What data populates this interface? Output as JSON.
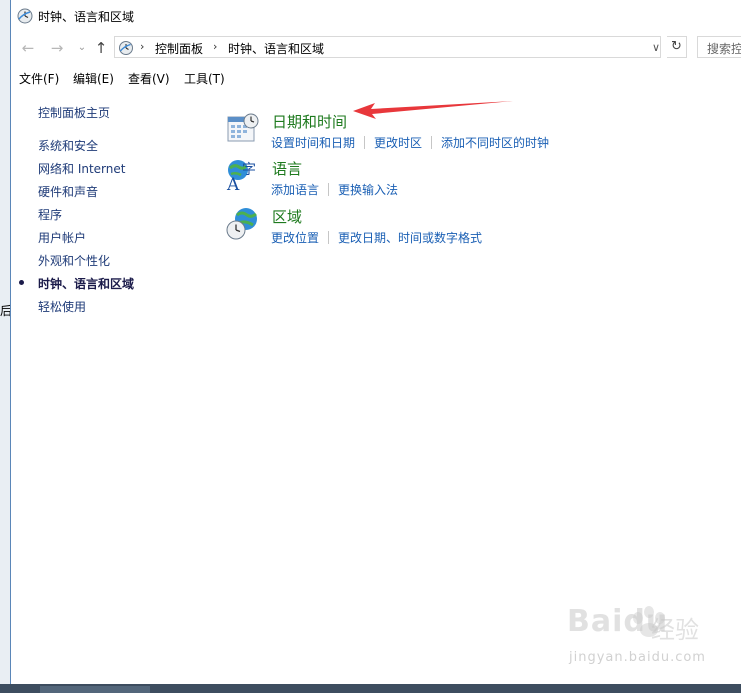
{
  "window": {
    "title": "时钟、语言和区域"
  },
  "nav": {
    "back_label": "←",
    "forward_label": "→",
    "dropdown_label": "⌄",
    "up_label": "↑",
    "breadcrumb": [
      "控制面板",
      "时钟、语言和区域"
    ],
    "breadcrumb_sep": "›",
    "address_dropdown": "∨",
    "refresh_label": "↻",
    "search_placeholder": "搜索控"
  },
  "menubar": {
    "items": [
      "文件(F)",
      "编辑(E)",
      "查看(V)",
      "工具(T)"
    ]
  },
  "sidebar": {
    "home": "控制面板主页",
    "items": [
      "系统和安全",
      "网络和 Internet",
      "硬件和声音",
      "程序",
      "用户帐户",
      "外观和个性化",
      "时钟、语言和区域",
      "轻松使用"
    ],
    "active_index": 6
  },
  "categories": [
    {
      "title": "日期和时间",
      "links": [
        "设置时间和日期",
        "更改时区",
        "添加不同时区的时钟"
      ],
      "icon": "calendar-clock-icon"
    },
    {
      "title": "语言",
      "links": [
        "添加语言",
        "更换输入法"
      ],
      "icon": "language-icon"
    },
    {
      "title": "区域",
      "links": [
        "更改位置",
        "更改日期、时间或数字格式"
      ],
      "icon": "globe-clock-icon"
    }
  ],
  "desktop": {
    "left_edge_text": "后"
  },
  "watermark": {
    "brand": "Baidu",
    "brand_suffix": "经验",
    "url": "jingyan.baidu.com"
  },
  "colors": {
    "category_title": "#1e7a1e",
    "link": "#1a5fb4",
    "sidebar_link": "#1f3b78",
    "annotation_arrow": "#e8373b"
  }
}
